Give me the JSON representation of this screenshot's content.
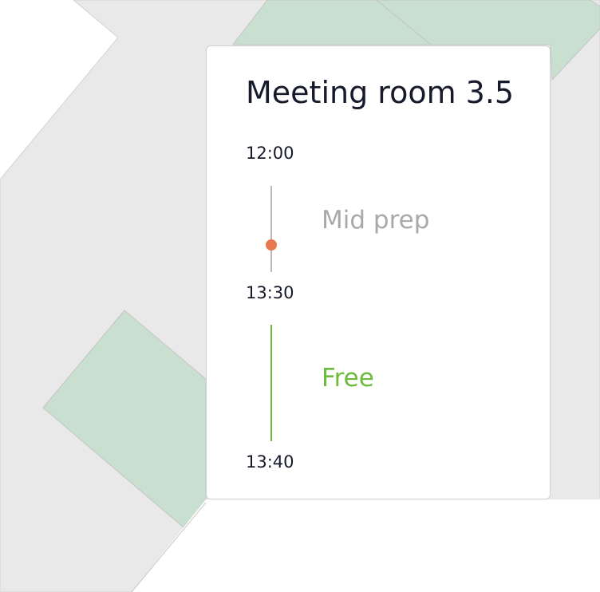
{
  "map": {
    "floor_color": "#e8e9e8",
    "room_color": "#c9dfd0",
    "outline_color": "#c8c8c8"
  },
  "room_card": {
    "title": "Meeting room 3.5",
    "schedule": [
      {
        "start": "12:00",
        "end": "13:30",
        "label": "Mid prep",
        "status": "busy",
        "color": "#a9a9a9"
      },
      {
        "start": "13:30",
        "end": "13:40",
        "label": "Free",
        "status": "free",
        "color": "#6dbb3c"
      }
    ],
    "times": [
      "12:00",
      "13:30",
      "13:40"
    ],
    "now_indicator_color": "#e9774f"
  }
}
